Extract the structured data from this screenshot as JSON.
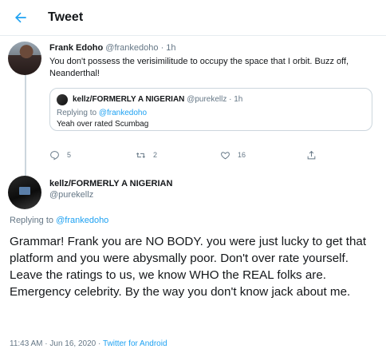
{
  "header": {
    "title": "Tweet"
  },
  "parent_tweet": {
    "author_name": "Frank Edoho",
    "meta": "@frankedoho · 1h",
    "text": "You don't possess the verisimilitude to occupy the space that I orbit. Buzz off, Neanderthal!",
    "quoted": {
      "author_name": "kellz/FORMERLY A NIGERIAN",
      "meta": "@purekellz · 1h",
      "replying_prefix": "Replying to ",
      "replying_handle": "@frankedoho",
      "text": "Yeah over rated Scumbag"
    },
    "actions": {
      "replies": "5",
      "retweets": "2",
      "likes": "16"
    }
  },
  "main_tweet": {
    "author_name": "kellz/FORMERLY A NIGERIAN",
    "handle": "@purekellz",
    "replying_prefix": "Replying to ",
    "replying_handle": "@frankedoho",
    "text": "Grammar! Frank you are NO BODY. you were just lucky to get that platform and you were abysmally poor. Don't over rate yourself. Leave the ratings to us, we know WHO the REAL folks are. Emergency celebrity. By the way you don't know jack about me.",
    "timestamp": "11:43 AM · Jun 16, 2020 · ",
    "source": "Twitter for Android"
  },
  "colors": {
    "accent": "#1da1f2",
    "muted": "#657786",
    "border": "#e6ecf0"
  },
  "icons": [
    "back-arrow-icon",
    "reply-icon",
    "retweet-icon",
    "like-icon",
    "share-icon"
  ]
}
